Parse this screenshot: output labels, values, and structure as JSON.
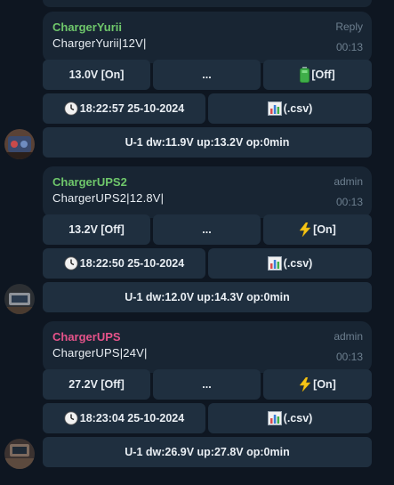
{
  "messages": [
    {
      "sender": "ChargerYurii",
      "sender_color": "#6fc76b",
      "role": "Reply",
      "text": "ChargerYurii|12V|",
      "time": "00:13",
      "buttons": {
        "voltage": "13.0V [On]",
        "more": "...",
        "status_label": "[Off]",
        "status_icon": "battery-icon",
        "timestamp": "18:22:57 25-10-2024",
        "timestamp_icon": "clock-icon",
        "csv": "(.csv)",
        "csv_icon": "bar-chart-icon",
        "summary": "U-1 dw:11.9V up:13.2V op:0min"
      }
    },
    {
      "sender": "ChargerUPS2",
      "sender_color": "#6fc76b",
      "role": "admin",
      "text": "ChargerUPS2|12.8V|",
      "time": "00:13",
      "buttons": {
        "voltage": "13.2V [Off]",
        "more": "...",
        "status_label": "[On]",
        "status_icon": "lightning-icon",
        "timestamp": "18:22:50 25-10-2024",
        "timestamp_icon": "clock-icon",
        "csv": "(.csv)",
        "csv_icon": "bar-chart-icon",
        "summary": "U-1 dw:12.0V up:14.3V op:0min"
      }
    },
    {
      "sender": "ChargerUPS",
      "sender_color": "#e6538a",
      "role": "admin",
      "text": "ChargerUPS|24V|",
      "time": "00:13",
      "buttons": {
        "voltage": "27.2V [Off]",
        "more": "...",
        "status_label": "[On]",
        "status_icon": "lightning-icon",
        "timestamp": "18:23:04 25-10-2024",
        "timestamp_icon": "clock-icon",
        "csv": "(.csv)",
        "csv_icon": "bar-chart-icon",
        "summary": "U-1 dw:26.9V up:27.8V op:0min"
      }
    }
  ],
  "colors": {
    "background": "#0e1621",
    "bubble": "#182533",
    "button": "#1f2f3f",
    "meta_text": "#6d7f8f"
  }
}
